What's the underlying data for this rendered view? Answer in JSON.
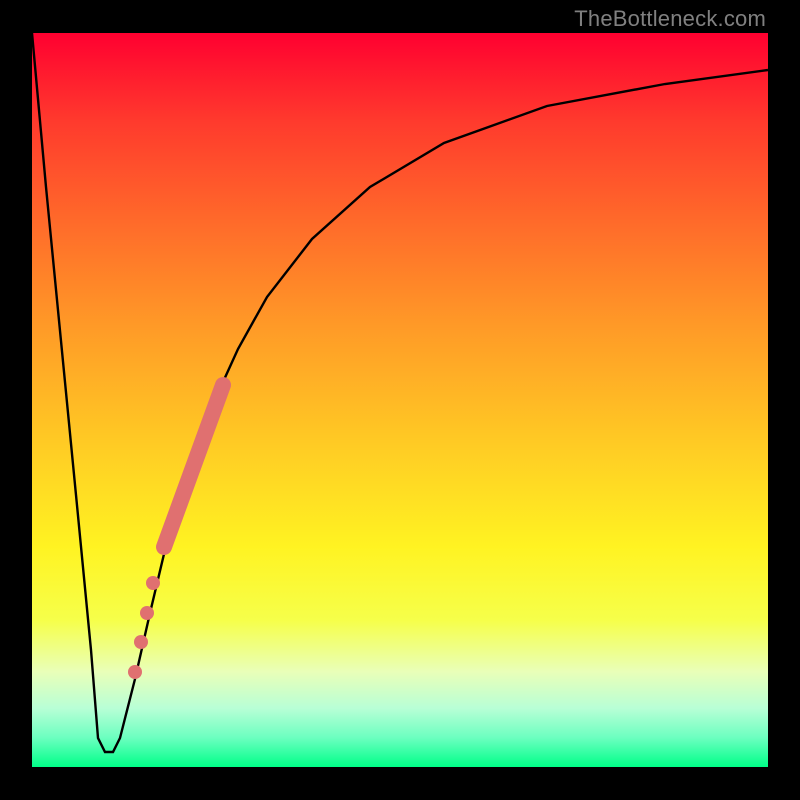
{
  "watermark": "TheBottleneck.com",
  "chart_data": {
    "type": "line",
    "title": "",
    "xlabel": "",
    "ylabel": "",
    "xlim": [
      0,
      100
    ],
    "ylim": [
      0,
      100
    ],
    "grid": false,
    "legend": false,
    "background_gradient": {
      "direction": "vertical",
      "stops": [
        {
          "pos": 0.0,
          "color": "#ff0030"
        },
        {
          "pos": 0.5,
          "color": "#ffc824"
        },
        {
          "pos": 0.8,
          "color": "#fbff3a"
        },
        {
          "pos": 1.0,
          "color": "#00ff88"
        }
      ]
    },
    "series": [
      {
        "name": "bottleneck-curve",
        "x": [
          0,
          2,
          4,
          6,
          8,
          9,
          10,
          11,
          12,
          14,
          16,
          18,
          20,
          24,
          28,
          32,
          38,
          46,
          56,
          70,
          86,
          100
        ],
        "y": [
          100,
          79,
          58,
          37,
          16,
          4,
          2,
          2,
          4,
          12,
          21,
          29,
          36,
          48,
          57,
          64,
          72,
          79,
          85,
          90,
          93,
          95
        ]
      }
    ],
    "highlight_segment": {
      "name": "thick-salmon-segment",
      "x_range": [
        18,
        26
      ],
      "y_range": [
        30,
        52
      ]
    },
    "highlight_points": [
      {
        "x": 16.5,
        "y": 25
      },
      {
        "x": 15.6,
        "y": 21
      },
      {
        "x": 14.8,
        "y": 17
      },
      {
        "x": 14.0,
        "y": 13
      }
    ],
    "colors": {
      "curve": "#000000",
      "highlight": "#e07070",
      "frame": "#000000"
    }
  }
}
